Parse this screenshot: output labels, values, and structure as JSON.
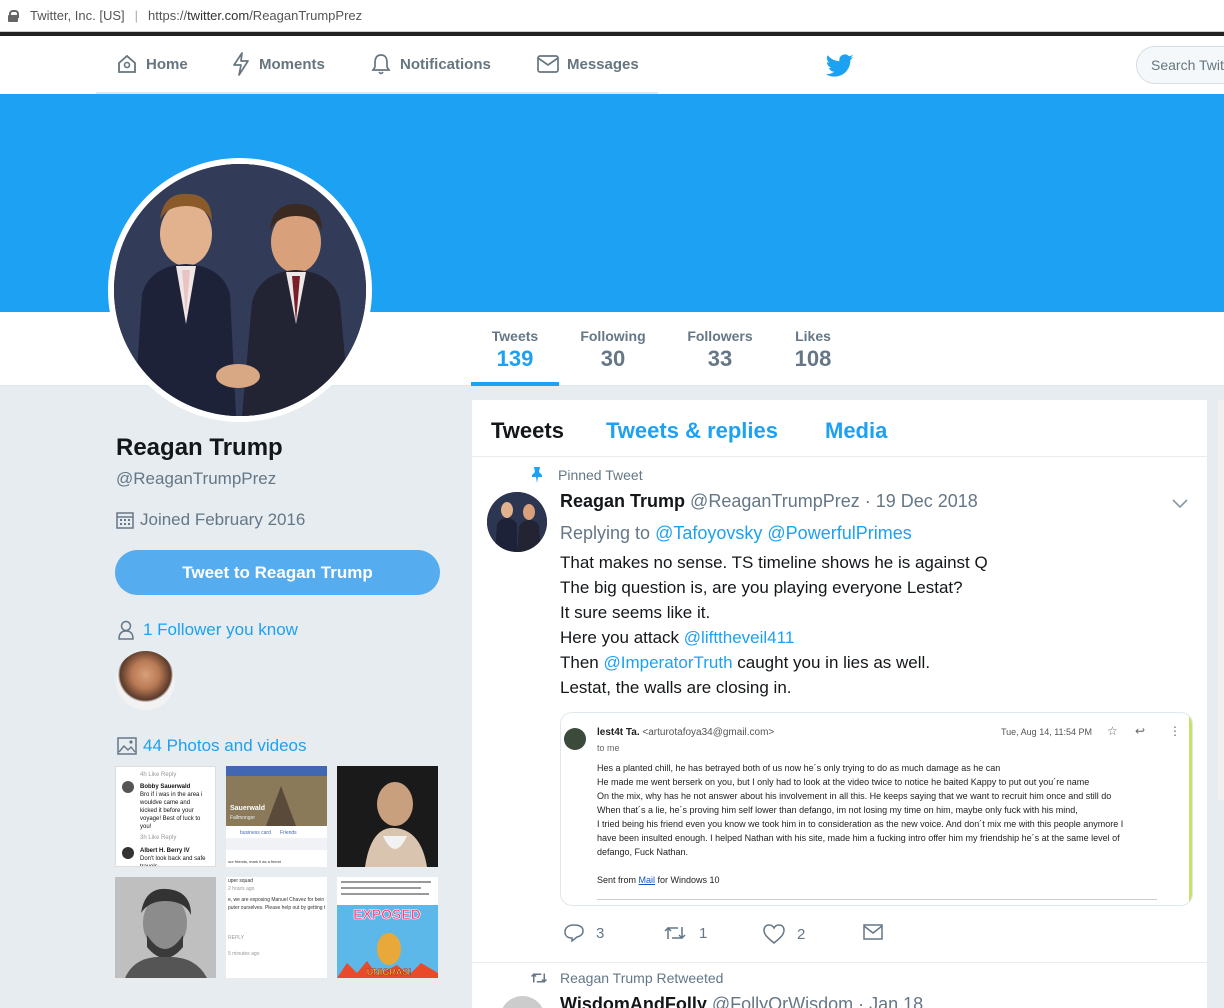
{
  "browser": {
    "site_identity": "Twitter, Inc. [US]",
    "url_scheme": "https://",
    "url_host": "twitter.com",
    "url_path": "/ReaganTrumpPrez"
  },
  "nav": {
    "home": "Home",
    "moments": "Moments",
    "notifications": "Notifications",
    "messages": "Messages",
    "search_placeholder": "Search Twitter"
  },
  "stats": {
    "tweets_label": "Tweets",
    "tweets_value": "139",
    "following_label": "Following",
    "following_value": "30",
    "followers_label": "Followers",
    "followers_value": "33",
    "likes_label": "Likes",
    "likes_value": "108"
  },
  "profile": {
    "name": "Reagan Trump",
    "handle": "@ReaganTrumpPrez",
    "joined": "Joined February 2016",
    "tweet_to": "Tweet to Reagan Trump",
    "followers_you_know": "1 Follower you know",
    "photos_videos": "44 Photos and videos"
  },
  "tabs": {
    "tweets": "Tweets",
    "replies": "Tweets & replies",
    "media": "Media"
  },
  "pinned": {
    "context": "Pinned Tweet",
    "name": "Reagan Trump",
    "handle": "@ReaganTrumpPrez",
    "date": "· 19 Dec 2018",
    "replying_prefix": "Replying to",
    "reply_mention_1": "@Tafoyovsky",
    "reply_mention_2": "@PowerfulPrimes",
    "line1": "That makes no sense. TS timeline shows he is against Q",
    "line2": "The big question is, are you playing everyone Lestat?",
    "line3": "It sure seems like it.",
    "line4_prefix": "Here you attack ",
    "line4_mention": "@lifttheveil411",
    "line5_prefix": "Then ",
    "line5_mention": "@ImperatorTruth",
    "line5_suffix": " caught you in lies as well.",
    "line6": "Lestat, the walls are closing in.",
    "replies": "3",
    "retweets": "1",
    "likes": "2"
  },
  "email": {
    "sender": "lest4t Ta.",
    "sender_email": "<arturotafoya34@gmail.com>",
    "to": "to me",
    "date": "Tue, Aug 14, 11:54 PM",
    "lines": [
      "Hes a planted chill, he has betrayed both of us now he´s only trying to do as much damage as he can",
      "He made me went berserk on you, but I only had to look at the video twice to notice he baited Kappy to put out you´re name",
      "On the mix, why has he not answer about his involvement in all this. He keeps saying that we want to recruit him once and still do",
      "When that´s a lie, he´s proving him self lower than defango, im not losing my time on  him, maybe only fuck with his mind,",
      "I tried being his friend even you know we took him in to consideration as the new voice. And don´t mix me with this people anymore I",
      "have been insulted enough. I helped Nathan with his site, made him a fucking intro offer him my friendship he´s at the same level of",
      "defango, Fuck Nathan."
    ],
    "sent_prefix": "Sent from ",
    "sent_link": "Mail",
    "sent_suffix": " for Windows 10"
  },
  "next_tweet": {
    "context": "Reagan Trump Retweeted",
    "name": "WisdomAndFolly",
    "handle": "@FollyOrWisdom · Jan 18"
  },
  "thumb_texts": {
    "t1_a": "4h   Like   Reply",
    "t1_b": "Bobby Sauerwald",
    "t1_c": "Bro if i was in the area i",
    "t1_d": "wouldve came and",
    "t1_e": "kicked it before your",
    "t1_f": "voyage! Best of luck to",
    "t1_g": "you!",
    "t1_h": "3h   Like   Reply",
    "t1_i": "Albert H. Berry IV",
    "t1_j": "Don't look back and safe",
    "t1_k": "travels",
    "t2_a": "Sauerwald",
    "t2_b": "Fallmonger",
    "t2_c": "business card",
    "t2_d": "Friends",
    "t2_e": "our friends, mark it as a friend",
    "t5_a": "uper squad",
    "t5_b": "2 hours ago",
    "t5_c": "e, we are exposing Manuel Chavez for bein",
    "t5_d": "puter ourselves. Please help out by getting t",
    "t5_e": "REPLY",
    "t5_f": "5 minutes ago",
    "t6_a": "EXPOSED",
    "t6_b": "UNIGRAS!"
  },
  "colors": {
    "brand": "#1da1f2",
    "button": "#55acee",
    "background": "#e6ecf0"
  }
}
